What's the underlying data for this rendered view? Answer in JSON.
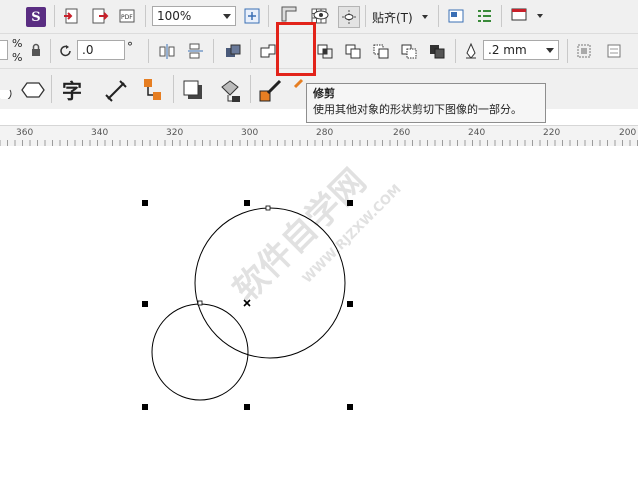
{
  "toolbar1": {
    "zoom_value": "100%",
    "snap_label": "贴齐(T)"
  },
  "toolbar2": {
    "percent_1": "%",
    "percent_2": "%",
    "rotation_value": ".0",
    "degree_symbol": "°",
    "outline_width": ".2 mm"
  },
  "tooltip": {
    "title": "修剪",
    "description": "使用其他对象的形状剪切下图像的一部分。"
  },
  "ruler": {
    "labels": [
      "360",
      "340",
      "320",
      "300",
      "280",
      "260",
      "240",
      "220",
      "200"
    ]
  },
  "watermark": {
    "main": "软件自学网",
    "sub": "WWW.RJZXW.COM"
  },
  "colors": {
    "highlight": "#e2231a",
    "toolbar_bg": "#f0f0f0",
    "accent_blue": "#3a6fb5"
  }
}
